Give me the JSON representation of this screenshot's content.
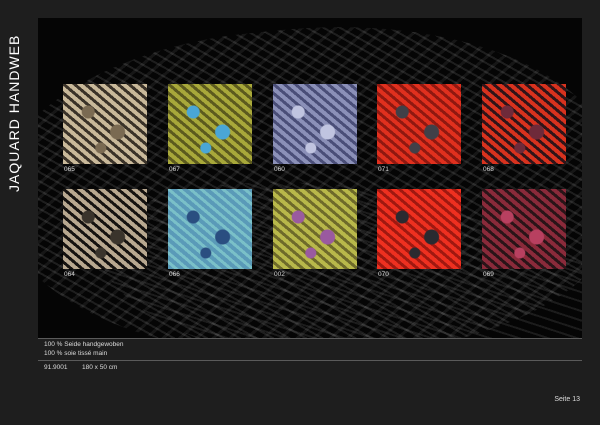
{
  "title": "JAQUARD HANDWEB",
  "products": [
    {
      "code": "065",
      "colors": [
        "#c9b99a",
        "#7a6a52",
        "#3a3228"
      ]
    },
    {
      "code": "067",
      "colors": [
        "#a8a83a",
        "#4aa6d6",
        "#5c5a1e"
      ]
    },
    {
      "code": "060",
      "colors": [
        "#8b90b8",
        "#c0c4e0",
        "#4a4e78"
      ]
    },
    {
      "code": "071",
      "colors": [
        "#e0301e",
        "#404048",
        "#901810"
      ]
    },
    {
      "code": "068",
      "colors": [
        "#d8321e",
        "#6e2a3a",
        "#301418"
      ]
    },
    {
      "code": "064",
      "colors": [
        "#b8a890",
        "#3a342c",
        "#151210"
      ]
    },
    {
      "code": "066",
      "colors": [
        "#5a9ab8",
        "#2a4e80",
        "#7ac0c8"
      ]
    },
    {
      "code": "002",
      "colors": [
        "#b8b84a",
        "#9a5aa0",
        "#6e6a2a"
      ]
    },
    {
      "code": "070",
      "colors": [
        "#ee3020",
        "#2a2a30",
        "#a01810"
      ]
    },
    {
      "code": "069",
      "colors": [
        "#8a2a3a",
        "#b84060",
        "#2a1418"
      ]
    }
  ],
  "material_de": "100 % Seide handgewoben",
  "material_fr": "100 % soie tissé main",
  "article": "91.9001",
  "size": "180 x 50 cm",
  "page": "Seite 13"
}
